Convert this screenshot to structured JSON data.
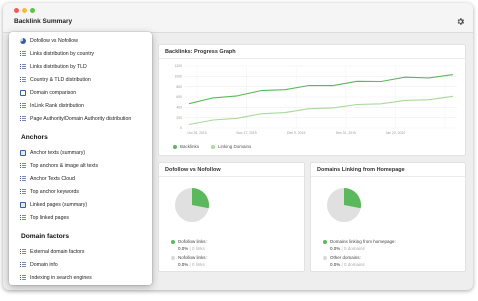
{
  "window": {
    "title": "Backlink Summary"
  },
  "menu": {
    "items": [
      {
        "label": "Dofollow vs Nofollow",
        "icon": "pie-chart-icon"
      },
      {
        "label": "Links distribution by country",
        "icon": "list-icon"
      },
      {
        "label": "Links distribution by TLD",
        "icon": "list-icon"
      },
      {
        "label": "Country & TLD distribution",
        "icon": "list-icon"
      },
      {
        "label": "Domain comparison",
        "icon": "document-icon"
      },
      {
        "label": "InLink Rank distribution",
        "icon": "list-icon"
      },
      {
        "label": "Page Authority/Domain Authority distribution",
        "icon": "list-icon"
      }
    ],
    "anchors_heading": "Anchors",
    "anchors": [
      {
        "label": "Anchor texts (summary)",
        "icon": "summary-icon"
      },
      {
        "label": "Top anchors & image alt texts",
        "icon": "list-icon"
      },
      {
        "label": "Anchor Texts Cloud",
        "icon": "list-icon"
      },
      {
        "label": "Top anchor keywords",
        "icon": "list-icon"
      },
      {
        "label": "Linked pages (summary)",
        "icon": "summary-icon"
      },
      {
        "label": "Top linked pages",
        "icon": "list-icon"
      }
    ],
    "domain_heading": "Domain factors",
    "domain": [
      {
        "label": "External domain factors",
        "icon": "list-icon"
      },
      {
        "label": "Domain info",
        "icon": "list-icon"
      },
      {
        "label": "Indexing in search engines",
        "icon": "list-icon"
      }
    ]
  },
  "progress": {
    "title": "Backlinks: Progress Graph",
    "legend": [
      {
        "label": "Backlinks",
        "color": "#5cb85c"
      },
      {
        "label": "Linking Domains",
        "color": "#a9d99a"
      }
    ]
  },
  "chart_data": {
    "type": "line",
    "title": "Backlinks: Progress Graph",
    "y_ticks": [
      "1200",
      "1000",
      "800",
      "600",
      "400",
      "200",
      "0"
    ],
    "x_ticks": [
      "Oct 26, 2019",
      "Nov 17, 2019",
      "Dec 9, 2019",
      "Dec 31, 2019",
      "Jan 22, 2020",
      ""
    ],
    "ylim": [
      0,
      1200
    ],
    "grid": true,
    "series": [
      {
        "name": "Backlinks",
        "color": "#5cb85c",
        "values": [
          490,
          560,
          640,
          700,
          760,
          800,
          840,
          880,
          920,
          960,
          990,
          1010
        ]
      },
      {
        "name": "Linking Domains",
        "color": "#a9d99a",
        "values": [
          80,
          140,
          200,
          260,
          310,
          360,
          400,
          440,
          480,
          520,
          560,
          600
        ]
      }
    ]
  },
  "dofollow": {
    "title": "Dofollow vs Nofollow",
    "pie_fraction": 0.28,
    "stats": [
      {
        "label": "Dofollow links:",
        "value": "0.0%",
        "sub": "| 0 links",
        "color": "#5cb85c"
      },
      {
        "label": "Nofollow links:",
        "value": "0.0%",
        "sub": "| 0 links",
        "color": "#d9d9d9"
      }
    ]
  },
  "domains_home": {
    "title": "Domains Linking from Homepage",
    "pie_fraction": 0.28,
    "stats": [
      {
        "label": "Domains linking from homepage:",
        "value": "0.0%",
        "sub": "| 0 domains",
        "color": "#5cb85c"
      },
      {
        "label": "Other domains:",
        "value": "0.0%",
        "sub": "| 0 domains",
        "color": "#d9d9d9"
      }
    ]
  },
  "colors": {
    "accent": "#5cb85c",
    "accent_light": "#a9d99a",
    "pie_bg": "#e0e0e0"
  }
}
